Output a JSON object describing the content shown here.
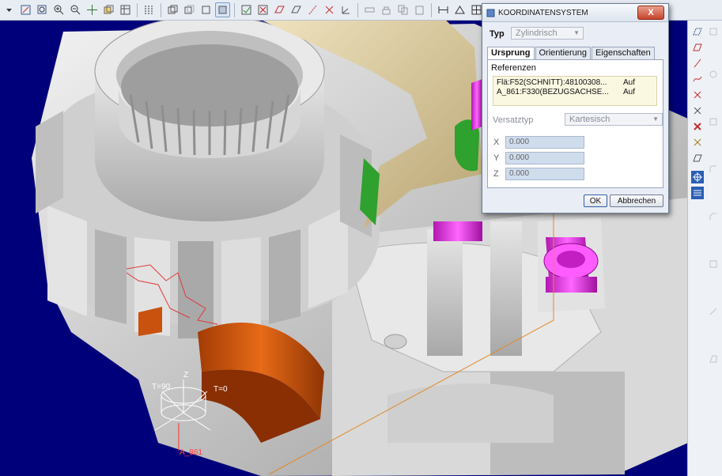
{
  "dialog": {
    "title": "KOORDINATENSYSTEM",
    "close_label": "X",
    "type_label": "Typ",
    "type_value": "Zylindrisch",
    "tabs": [
      {
        "label": "Ursprung"
      },
      {
        "label": "Orientierung"
      },
      {
        "label": "Eigenschaften"
      }
    ],
    "references_label": "Referenzen",
    "references": [
      {
        "name": "Flä:F52(SCHNITT):48100308...",
        "state": "Auf"
      },
      {
        "name": "A_861:F330(BEZUGSACHSE...",
        "state": "Auf"
      }
    ],
    "offset_type_label": "Versatztyp",
    "offset_type_value": "Kartesisch",
    "fields": [
      {
        "label": "X",
        "value": "0.000"
      },
      {
        "label": "Y",
        "value": "0.000"
      },
      {
        "label": "Z",
        "value": "0.000"
      }
    ],
    "ok_label": "OK",
    "cancel_label": "Abbrechen"
  },
  "viewport": {
    "csys_labels": {
      "theta90": "T=90",
      "theta0": "T=0",
      "z": "Z",
      "axis": "A_861"
    }
  },
  "colors": {
    "background": "#00007a",
    "part_gray": "#c8c8c8",
    "bracket_tan": "#d8c79a",
    "highlight_magenta": "#e030e0",
    "highlight_green": "#2ea12e",
    "section_orange": "#c9520f"
  }
}
